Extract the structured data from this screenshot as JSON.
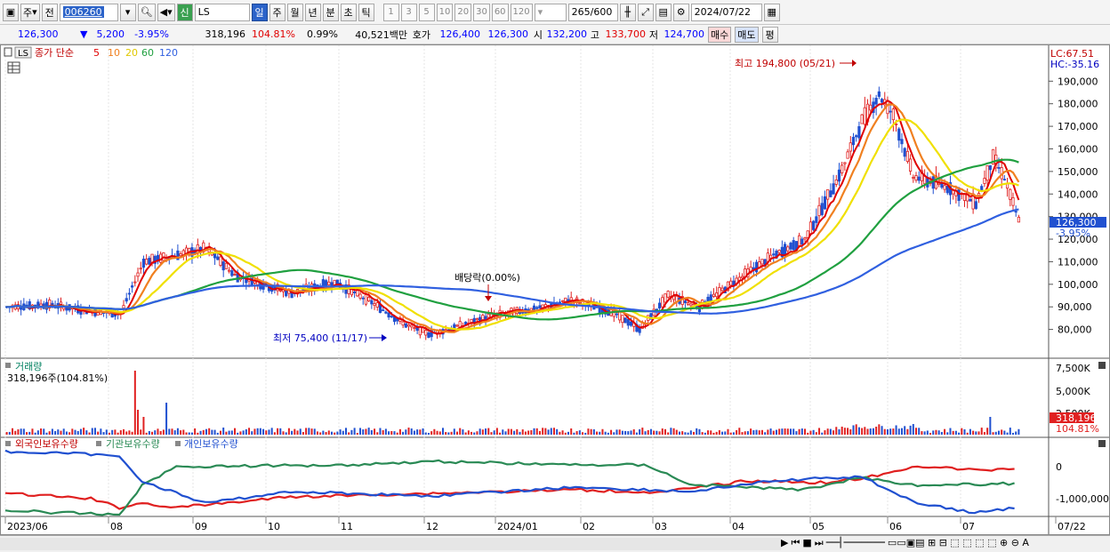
{
  "toolbar": {
    "market": "주",
    "prev": "전",
    "code": "006260",
    "new_tag": "신",
    "name": "LS",
    "periods": [
      "일",
      "주",
      "월",
      "년",
      "분",
      "초",
      "틱"
    ],
    "intervals": [
      "1",
      "3",
      "5",
      "10",
      "20",
      "30",
      "60",
      "120"
    ],
    "count": "265",
    "count_total": "/600",
    "date": "2024/07/22"
  },
  "info": {
    "price": "126,300",
    "change": "5,200",
    "pct": "-3.95%",
    "volume": "318,196",
    "vol_ratio": "104.81%",
    "turnover": "0.99%",
    "amount": "40,521백만",
    "quote_label": "호가",
    "ask": "126,400",
    "bid": "126,300",
    "open_label": "시",
    "open": "132,200",
    "high_label": "고",
    "high": "133,700",
    "low_label": "저",
    "low": "124,700",
    "buy": "매수",
    "sell": "매도",
    "avg": "평"
  },
  "price_panel": {
    "name": "LS",
    "legend_label": "종가 단순",
    "ma_labels": [
      "5",
      "10",
      "20",
      "60",
      "120"
    ],
    "ma_colors": [
      "#e00000",
      "#f08020",
      "#f0e000",
      "#20a040",
      "#3060e0"
    ],
    "lc": "LC:67.51",
    "hc": "HC:-35.16",
    "high_annot": "최고 194,800 (05/21)",
    "low_annot": "최저 75,400 (11/17)",
    "div_annot": "배당락(0.00%)",
    "current_tag": "126,300",
    "current_pct": "-3.95%",
    "yticks": [
      "190,000",
      "180,000",
      "170,000",
      "160,000",
      "150,000",
      "140,000",
      "130,000",
      "120,000",
      "110,000",
      "100,000",
      "90,000",
      "80,000"
    ]
  },
  "volume_panel": {
    "title": "거래량",
    "subtitle": "318,196주(104.81%)",
    "yticks": [
      "7,500K",
      "5,000K",
      "2,500K"
    ],
    "tag": "318,196",
    "tag2": "104.81%"
  },
  "flow_panel": {
    "labels": [
      "외국인보유수량",
      "기관보유수량",
      "개인보유수량"
    ],
    "yticks": [
      "0",
      "-1,000,000"
    ]
  },
  "xaxis": [
    "2023/06",
    "08",
    "09",
    "10",
    "11",
    "12",
    "2024/01",
    "02",
    "03",
    "04",
    "05",
    "06",
    "07",
    "07/22"
  ],
  "chart_data": {
    "type": "line",
    "title": "LS",
    "ylabel": "",
    "ylim": [
      70000,
      200000
    ],
    "x": [
      "2023/06",
      "2023/07",
      "2023/08",
      "2023/09",
      "2023/10",
      "2023/11",
      "2023/12",
      "2024/01",
      "2024/02",
      "2024/03",
      "2024/04",
      "2024/05",
      "2024/06",
      "2024/07",
      "2024/07/22"
    ],
    "series": [
      {
        "name": "5",
        "values": [
          90000,
          88000,
          115000,
          105000,
          100000,
          80000,
          88000,
          92000,
          80000,
          95000,
          115000,
          165000,
          175000,
          148000,
          126300
        ]
      },
      {
        "name": "120",
        "values": [
          78000,
          82000,
          90000,
          95000,
          97000,
          95000,
          95000,
          94000,
          92000,
          89000,
          92000,
          100000,
          115000,
          120000,
          125000
        ]
      }
    ],
    "annotations": [
      "최고 194,800 (05/21)",
      "최저 75,400 (11/17)",
      "배당락(0.00%)"
    ]
  }
}
